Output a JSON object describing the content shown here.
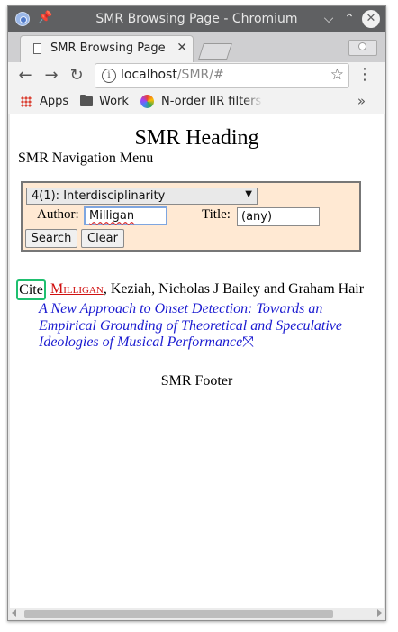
{
  "window": {
    "title": "SMR Browsing Page - Chromium",
    "controls": {
      "minimize": "⌵",
      "maximize": "⌃",
      "close": "✕"
    }
  },
  "tabs": [
    {
      "title": "SMR Browsing Page",
      "close": "✕"
    }
  ],
  "toolbar": {
    "back": "←",
    "forward": "→",
    "reload": "↻",
    "info": "i",
    "url_host": "localhost",
    "url_path": "/SMR/#",
    "star": "☆",
    "menu": "⋮"
  },
  "bookmarks": {
    "items": [
      "Apps",
      "Work",
      "N-order IIR filters c"
    ],
    "more": "»"
  },
  "page": {
    "heading": "SMR Heading",
    "nav_menu": "SMR Navigation Menu",
    "search_form": {
      "category_selected": "4(1): Interdisciplinarity",
      "author_label": "Author:",
      "author_value": "Milligan",
      "title_label": "Title:",
      "title_value": "(any)",
      "search_button": "Search",
      "clear_button": "Clear"
    },
    "result": {
      "cite": "Cite",
      "first_author": "Milligan",
      "rest_authors": ", Keziah, Nicholas J Bailey and Graham Hair",
      "title": "A New Approach to Onset Detection: Towards an Empirical Grounding of Theoretical and Speculative Ideologies of Musical Performance",
      "title_suffix": "⤧"
    },
    "footer": "SMR Footer"
  },
  "colors": {
    "titlebar": "#5f6062",
    "form_background": "#ffe9d3",
    "author_link": "#d01010",
    "title_link": "#1a1ad0",
    "cite_border": "#1fbf6f"
  }
}
